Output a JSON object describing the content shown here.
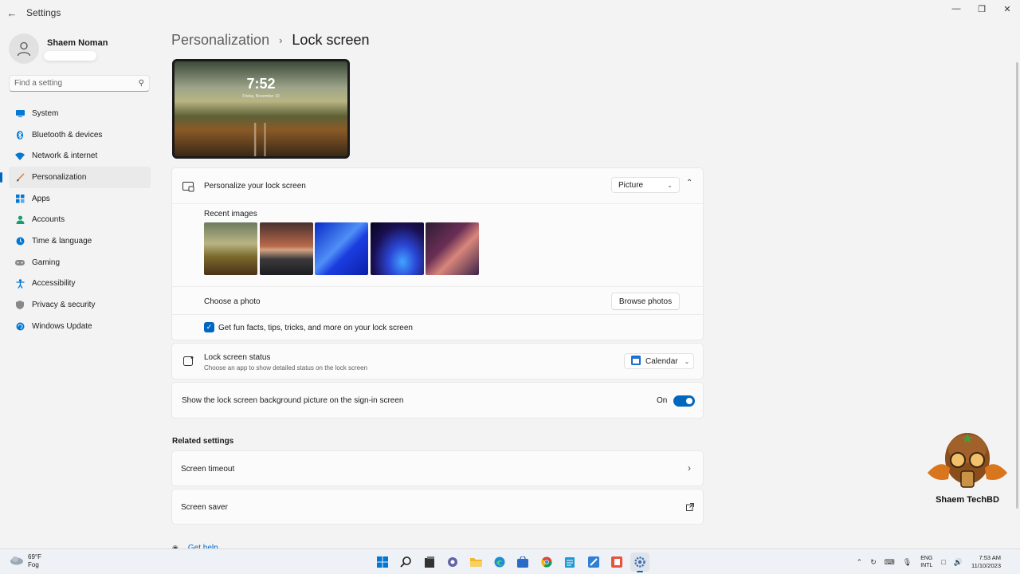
{
  "window": {
    "title": "Settings",
    "back_icon": "back-arrow-icon",
    "controls": [
      "minimize",
      "restore",
      "close"
    ]
  },
  "profile": {
    "name": "Shaem Noman"
  },
  "search": {
    "placeholder": "Find a setting"
  },
  "sidebar": {
    "items": [
      {
        "label": "System",
        "icon": "monitor-icon",
        "active": false
      },
      {
        "label": "Bluetooth & devices",
        "icon": "bluetooth-icon",
        "active": false
      },
      {
        "label": "Network & internet",
        "icon": "wifi-icon",
        "active": false
      },
      {
        "label": "Personalization",
        "icon": "brush-icon",
        "active": true
      },
      {
        "label": "Apps",
        "icon": "apps-icon",
        "active": false
      },
      {
        "label": "Accounts",
        "icon": "person-icon",
        "active": false
      },
      {
        "label": "Time & language",
        "icon": "globe-clock-icon",
        "active": false
      },
      {
        "label": "Gaming",
        "icon": "gamepad-icon",
        "active": false
      },
      {
        "label": "Accessibility",
        "icon": "accessibility-icon",
        "active": false
      },
      {
        "label": "Privacy & security",
        "icon": "shield-icon",
        "active": false
      },
      {
        "label": "Windows Update",
        "icon": "update-icon",
        "active": false
      }
    ]
  },
  "breadcrumb": {
    "parent": "Personalization",
    "separator": "›",
    "current": "Lock screen"
  },
  "preview": {
    "time": "7:52",
    "date": "Friday, November 10"
  },
  "personalize": {
    "label": "Personalize your lock screen",
    "value": "Picture",
    "recent_images_label": "Recent images",
    "choose_photo_label": "Choose a photo",
    "browse_label": "Browse photos",
    "fun_facts_label": "Get fun facts, tips, tricks, and more on your lock screen",
    "fun_facts_checked": true
  },
  "status": {
    "label": "Lock screen status",
    "sub": "Choose an app to show detailed status on the lock screen",
    "value": "Calendar"
  },
  "signin": {
    "label": "Show the lock screen background picture on the sign-in screen",
    "state_label": "On",
    "on": true
  },
  "related": {
    "title": "Related settings",
    "items": [
      {
        "label": "Screen timeout",
        "icon": "chevron-right-icon"
      },
      {
        "label": "Screen saver",
        "icon": "external-link-icon"
      }
    ]
  },
  "get_help": "Get help",
  "logo": {
    "text": "Shaem TechBD"
  },
  "taskbar": {
    "weather_temp": "69°F",
    "weather_desc": "Fog",
    "apps": [
      "start-icon",
      "search-icon",
      "file-icon",
      "chat-icon",
      "folder-icon",
      "edge-icon",
      "store-icon",
      "chrome-icon",
      "notepad-icon",
      "paint-icon",
      "office-icon",
      "settings-icon"
    ],
    "lang_top": "ENG",
    "lang_bottom": "INTL",
    "time": "7:53 AM",
    "date": "11/10/2023"
  },
  "colors": {
    "accent": "#0067c0",
    "background": "#f3f3f3",
    "card": "#fbfbfb"
  }
}
